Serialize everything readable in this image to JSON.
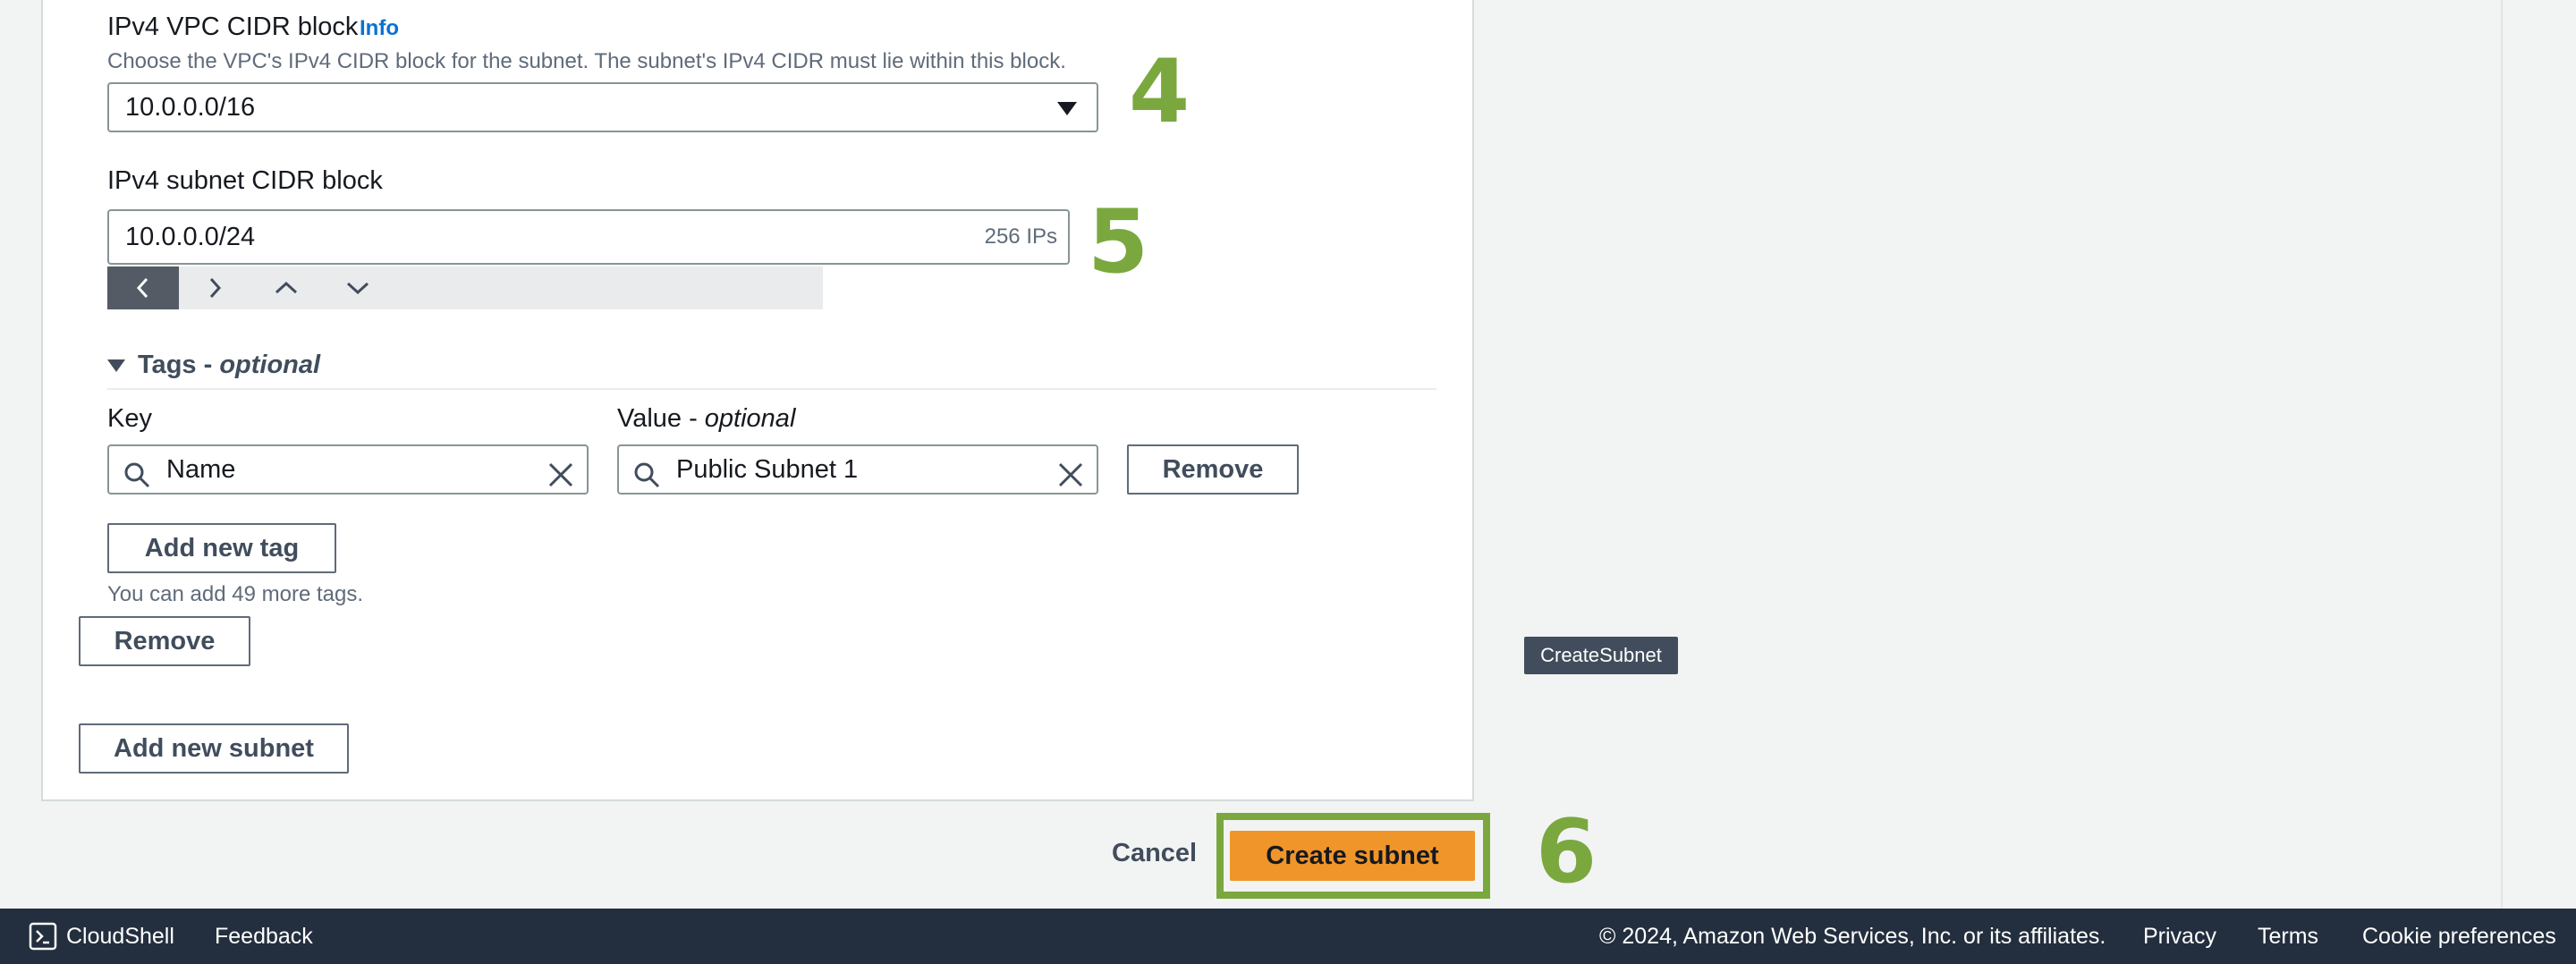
{
  "vpc_cidr": {
    "label": "IPv4 VPC CIDR block",
    "info_link": "Info",
    "description": "Choose the VPC's IPv4 CIDR block for the subnet. The subnet's IPv4 CIDR must lie within this block.",
    "selected_value": "10.0.0.0/16"
  },
  "subnet_cidr": {
    "label": "IPv4 subnet CIDR block",
    "value": "10.0.0.0/24",
    "hint": "256 IPs",
    "stepper_icons": [
      "chevron-left-icon",
      "chevron-right-icon",
      "chevron-up-icon",
      "chevron-down-icon"
    ]
  },
  "annotations": {
    "step4": "4",
    "step5": "5",
    "step6": "6"
  },
  "tags": {
    "heading": "Tags - ",
    "heading_optional": "optional",
    "key_label": "Key",
    "value_label": "Value - ",
    "value_label_optional": "optional",
    "key_value": "Name",
    "value_value": "Public Subnet 1",
    "remove_label": "Remove",
    "add_tag_label": "Add new tag",
    "remaining_text": "You can add 49 more tags."
  },
  "subnet_actions": {
    "remove_label": "Remove",
    "add_subnet_label": "Add new subnet"
  },
  "tooltip": "CreateSubnet",
  "form_actions": {
    "cancel_label": "Cancel",
    "create_label": "Create subnet"
  },
  "footer": {
    "cloudshell": "CloudShell",
    "feedback": "Feedback",
    "copyright": "© 2024, Amazon Web Services, Inc. or its affiliates.",
    "privacy": "Privacy",
    "terms": "Terms",
    "cookie": "Cookie preferences"
  },
  "colors": {
    "accent_green": "#7aa83e",
    "primary_orange": "#f0952a",
    "link_blue": "#0972d3",
    "footer_bg": "#232f3e"
  }
}
